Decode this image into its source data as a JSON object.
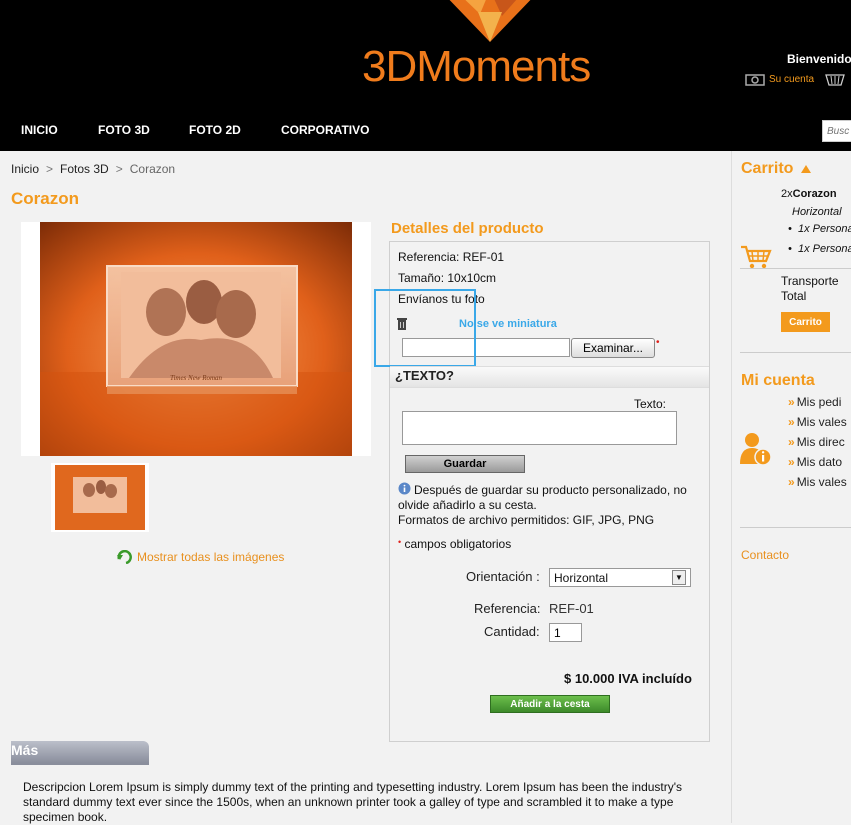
{
  "header": {
    "logo_text": "3DMoments",
    "welcome": "Bienvenido,",
    "account_link": "Su cuenta",
    "nav": [
      "INICIO",
      "FOTO 3D",
      "FOTO 2D",
      "CORPORATIVO"
    ],
    "search_placeholder": "Busc"
  },
  "breadcrumb": [
    "Inicio",
    "Fotos 3D",
    "Corazon"
  ],
  "breadcrumb_sep": ">",
  "product": {
    "title": "Corazon",
    "engraving_text": "Times New Roman",
    "show_all_images": "Mostrar todas las imágenes"
  },
  "details": {
    "title": "Detalles del producto",
    "referencia_line": "Referencia: REF-01",
    "tamano_line": "Tamaño: 10x10cm",
    "envianos": "Envíanos tu foto",
    "no_thumb_note": "No se ve miniatura",
    "browse_label": "Examinar...",
    "texto_header": "¿TEXTO?",
    "texto_label": "Texto:",
    "save_label": "Guardar",
    "info_text": "Después de guardar su producto personalizado, no olvide añadirlo a su cesta.",
    "formats": "Formatos de archivo permitidos: GIF, JPG, PNG",
    "required_note": "campos obligatorios",
    "orientation_label": "Orientación :",
    "orientation_value": "Horizontal",
    "reference_label": "Referencia:",
    "reference_value": "REF-01",
    "quantity_label": "Cantidad:",
    "quantity_value": "1",
    "price": "$ 10.000 IVA incluído",
    "add_to_cart": "Añadir a la cesta"
  },
  "more": {
    "tab_label": "Más",
    "description": "Descripcion Lorem Ipsum is simply dummy text of the printing and typesetting industry. Lorem Ipsum has been the industry's standard dummy text ever since the 1500s, when an unknown printer took a galley of type and scrambled it to make a type specimen book."
  },
  "cart": {
    "title": "Carrito",
    "item_qty": "2x",
    "item_name": "Corazon",
    "item_variant": "Horizontal",
    "sub_items": [
      "1x Persona",
      "1x Persona"
    ],
    "transport": "Transporte",
    "total": "Total",
    "button": "Carrito"
  },
  "account": {
    "title": "Mi cuenta",
    "items": [
      "Mis pedi",
      "Mis vales",
      "Mis direc",
      "Mis dato",
      "Mis vales"
    ]
  },
  "contact": "Contacto",
  "colors": {
    "accent": "#f39a1d",
    "header_bg": "#000000",
    "highlight": "#3aa8e8",
    "add_button": "#4e9c35"
  }
}
